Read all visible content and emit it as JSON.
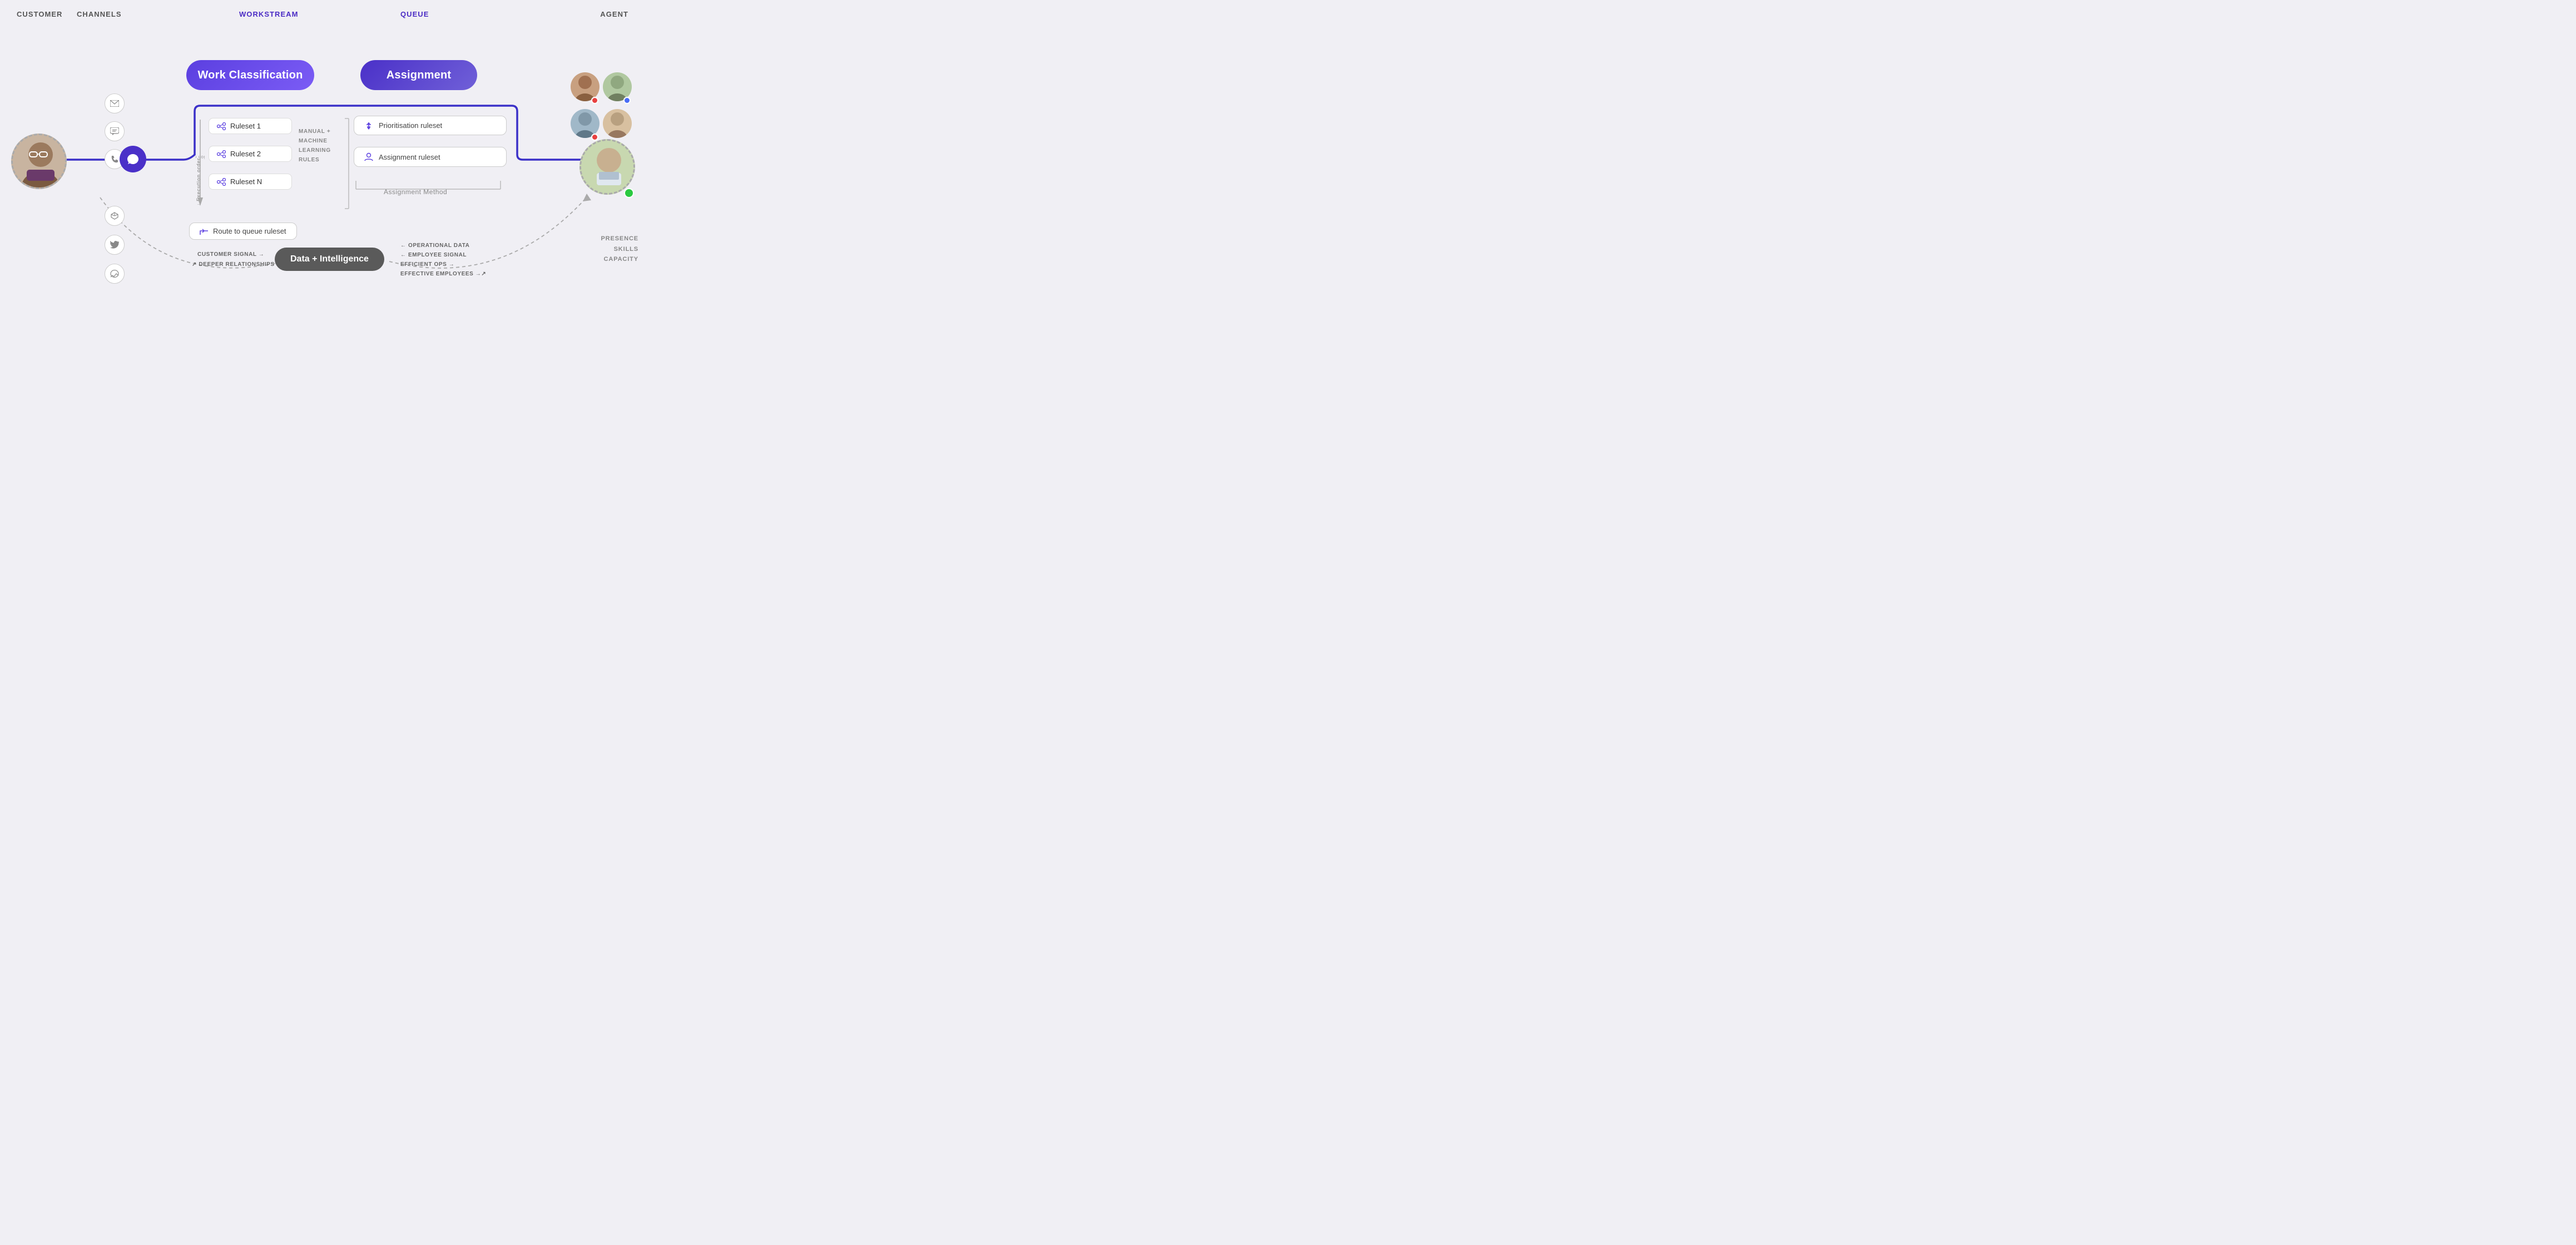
{
  "headers": {
    "customer": "CUSTOMER",
    "channels": "CHANNELS",
    "workstream": "WORKSTREAM",
    "queue": "QUEUE",
    "agent": "AGENT"
  },
  "pills": {
    "work_classification": "Work Classification",
    "assignment": "Assignment"
  },
  "rulesets": [
    {
      "label": "Ruleset 1"
    },
    {
      "label": "Ruleset 2"
    },
    {
      "label": "Ruleset N"
    }
  ],
  "ml_label": "MANUAL +\nMACHINE\nLEARNING\nRULES",
  "execution_order": "↓ Execution order",
  "route_to_queue": "Route to queue ruleset",
  "assignment_items": [
    {
      "label": "Prioritisation ruleset",
      "icon": "sort"
    },
    {
      "label": "Assignment ruleset",
      "icon": "person"
    }
  ],
  "assignment_method": "Assignment Method",
  "data_intelligence": "Data + Intelligence",
  "arrow_labels": {
    "customer_signal": "CUSTOMER SIGNAL →",
    "deeper_relationships": "↗ DEEPER RELATIONSHIPS",
    "operational_data": "← OPERATIONAL DATA",
    "employee_signal": "← EMPLOYEE SIGNAL",
    "efficient_ops": "EFFICIENT OPS →",
    "effective_employees": "EFFECTIVE EMPLOYEES →↗"
  },
  "presence_labels": [
    "PRESENCE",
    "SKILLS",
    "CAPACITY"
  ],
  "channels": [
    "email",
    "sms",
    "phone",
    "cube",
    "twitter",
    "messenger"
  ]
}
